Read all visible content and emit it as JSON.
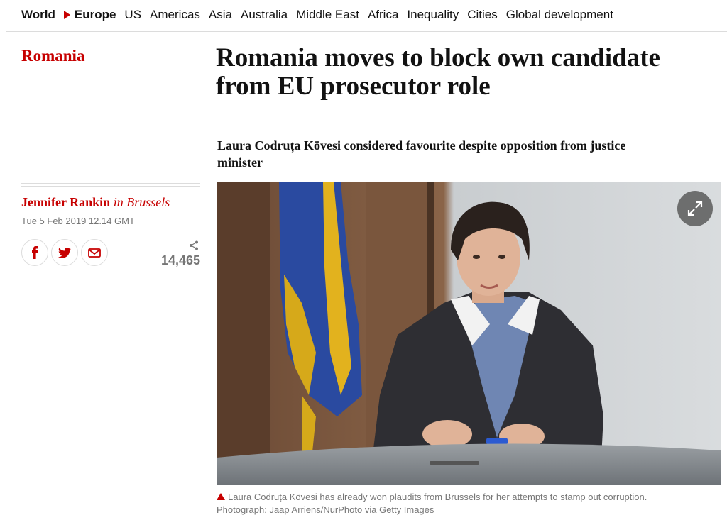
{
  "nav": {
    "items": [
      {
        "label": "World",
        "strong": true,
        "name": "nav-world"
      },
      {
        "label": "Europe",
        "strong": true,
        "arrow": true,
        "name": "nav-europe"
      },
      {
        "label": "US",
        "name": "nav-us"
      },
      {
        "label": "Americas",
        "name": "nav-americas"
      },
      {
        "label": "Asia",
        "name": "nav-asia"
      },
      {
        "label": "Australia",
        "name": "nav-australia"
      },
      {
        "label": "Middle East",
        "name": "nav-middle-east"
      },
      {
        "label": "Africa",
        "name": "nav-africa"
      },
      {
        "label": "Inequality",
        "name": "nav-inequality"
      },
      {
        "label": "Cities",
        "name": "nav-cities"
      },
      {
        "label": "Global development",
        "name": "nav-global-development"
      }
    ]
  },
  "section": {
    "label": "Romania"
  },
  "article": {
    "headline": "Romania moves to block own candidate from EU prosecutor role",
    "standfirst": "Laura Codruța Kövesi considered favourite despite opposition from justice minister",
    "author": "Jennifer Rankin",
    "location": "in Brussels",
    "date": "Tue 5 Feb 2019 12.14 GMT"
  },
  "share": {
    "buttons": [
      {
        "name": "facebook-share-button",
        "icon": "facebook-icon"
      },
      {
        "name": "twitter-share-button",
        "icon": "twitter-icon"
      },
      {
        "name": "email-share-button",
        "icon": "email-icon"
      }
    ],
    "count": "14,465"
  },
  "image": {
    "caption": "Laura Codruța Kövesi has already won plaudits from Brussels for her attempts to stamp out corruption.",
    "credit": "Photograph: Jaap Arriens/NurPhoto via Getty Images",
    "expand_icon": "expand-icon"
  },
  "colors": {
    "accent": "#c70000",
    "text": "#121212",
    "muted": "#767676",
    "rule": "#dcdcdc"
  }
}
